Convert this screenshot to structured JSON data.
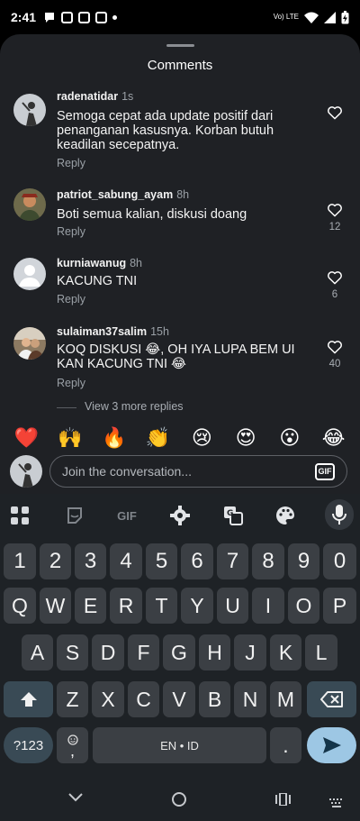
{
  "status_bar": {
    "time": "2:41",
    "network": "Vo) LTE",
    "icons": [
      "message-icon",
      "gallery-icon",
      "instagram-icon",
      "instagram-icon",
      "dot-icon",
      "wifi-icon",
      "signal-icon",
      "battery-icon"
    ]
  },
  "sheet": {
    "title": "Comments",
    "comments": [
      {
        "user": "radenatidar",
        "time": "1s",
        "text": "Semoga cepat ada update positif dari penanganan kasusnya. Korban butuh keadilan secepatnya.",
        "reply": "Reply",
        "likes": ""
      },
      {
        "user": "patriot_sabung_ayam",
        "time": "8h",
        "text": "Boti semua kalian, diskusi doang",
        "reply": "Reply",
        "likes": "12"
      },
      {
        "user": "kurniawanug",
        "time": "8h",
        "text": "KACUNG TNI",
        "reply": "Reply",
        "likes": "6"
      },
      {
        "user": "sulaiman37salim",
        "time": "15h",
        "text": "KOQ DISKUSI 😂, OH IYA LUPA BEM UI KAN KACUNG TNI 😂",
        "reply": "Reply",
        "likes": "40"
      }
    ],
    "more_replies": "View 3 more replies",
    "reactions": [
      "❤️",
      "🙌",
      "🔥",
      "👏",
      "😢",
      "😍",
      "😮",
      "😂"
    ],
    "compose_placeholder": "Join the conversation...",
    "gif_label": "GIF"
  },
  "keyboard": {
    "toolbar": {
      "gif_label": "GIF"
    },
    "number_row": [
      "1",
      "2",
      "3",
      "4",
      "5",
      "6",
      "7",
      "8",
      "9",
      "0"
    ],
    "row1": [
      "Q",
      "W",
      "E",
      "R",
      "T",
      "Y",
      "U",
      "I",
      "O",
      "P"
    ],
    "row2": [
      "A",
      "S",
      "D",
      "F",
      "G",
      "H",
      "J",
      "K",
      "L"
    ],
    "row3": [
      "Z",
      "X",
      "C",
      "V",
      "B",
      "N",
      "M"
    ],
    "symbols_label": "?123",
    "emoji_comma": ",",
    "space_label": "EN • ID",
    "period": "."
  },
  "colors": {
    "sheet_bg": "#1f2125",
    "keyboard_bg": "#1e2226",
    "key_bg": "#3b3f44",
    "func_key_bg": "#394a55",
    "enter_key_bg": "#9dc7e4"
  }
}
